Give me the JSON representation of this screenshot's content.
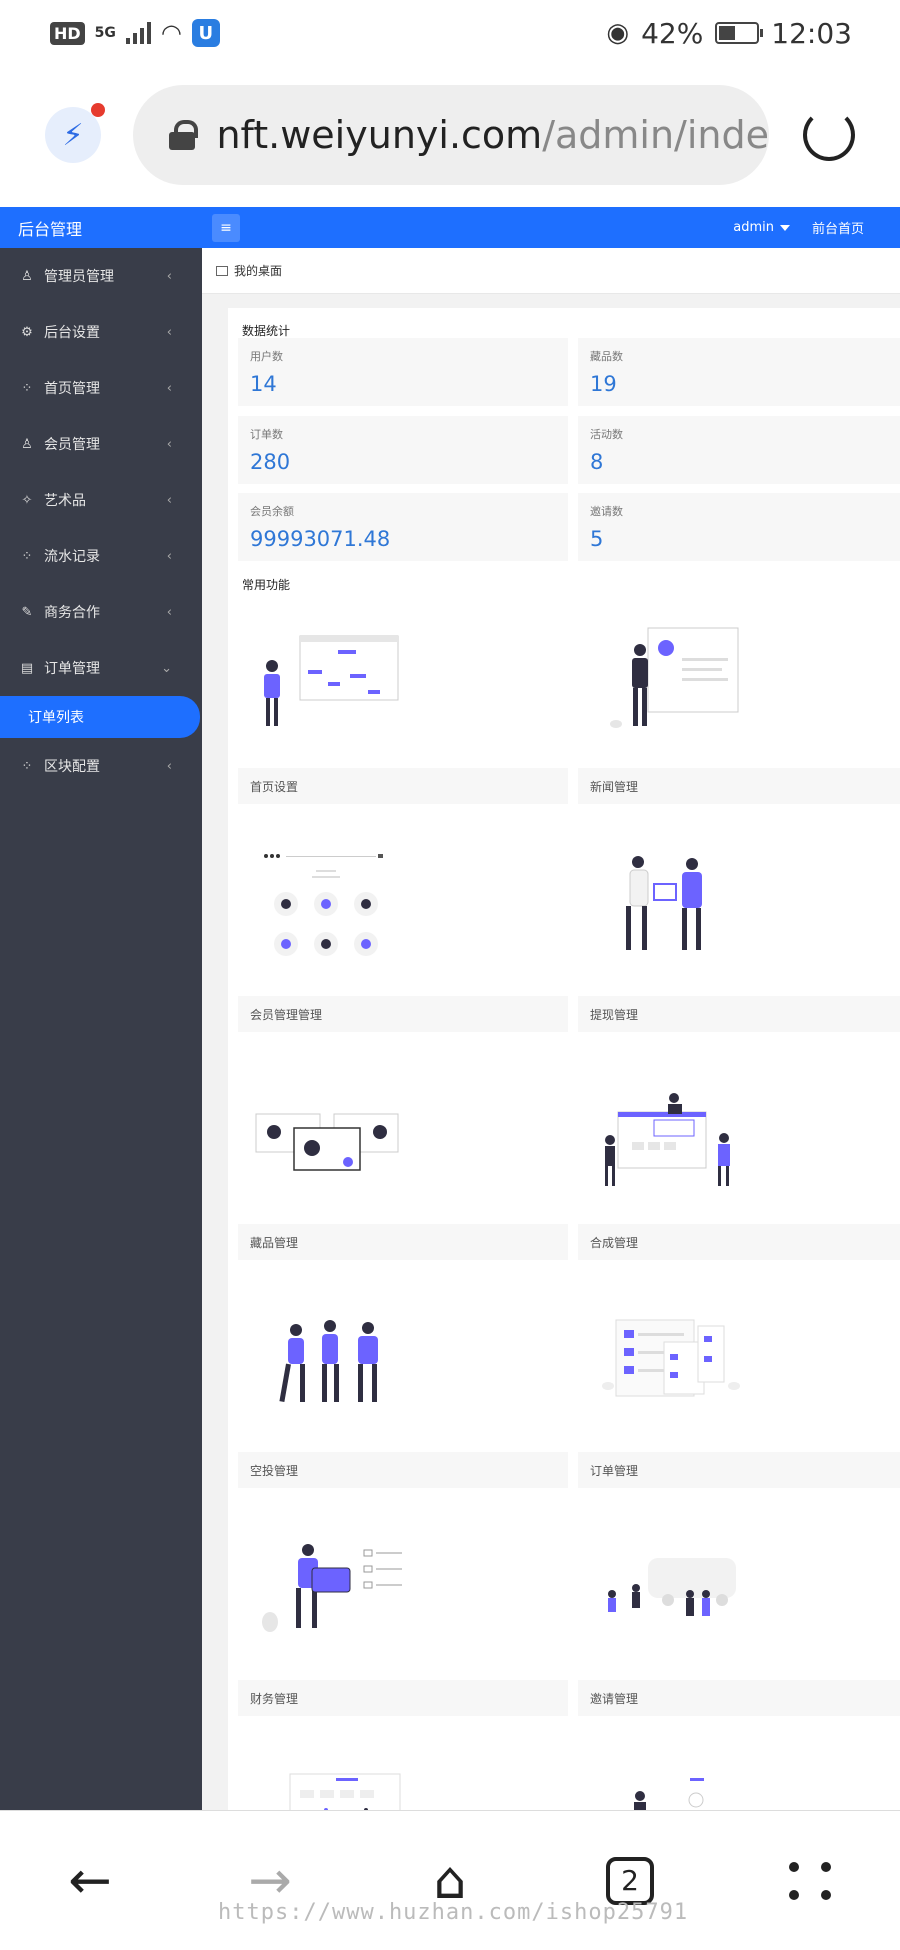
{
  "status_bar": {
    "hd": "HD",
    "network": "5G",
    "battery": "42%",
    "time": "12:03"
  },
  "browser": {
    "url_host": "nft.weiyunyi.com",
    "url_path": "/admin/inde"
  },
  "header": {
    "title": "后台管理",
    "user": "admin",
    "front_link": "前台首页"
  },
  "sidebar": {
    "items": [
      {
        "label": "管理员管理",
        "icon": "user-icon"
      },
      {
        "label": "后台设置",
        "icon": "gear-icon"
      },
      {
        "label": "首页管理",
        "icon": "apps-icon"
      },
      {
        "label": "会员管理",
        "icon": "user-icon"
      },
      {
        "label": "艺术品",
        "icon": "pin-icon"
      },
      {
        "label": "流水记录",
        "icon": "apps-icon"
      },
      {
        "label": "商务合作",
        "icon": "edit-icon"
      },
      {
        "label": "订单管理",
        "icon": "form-icon"
      }
    ],
    "active_sub": "订单列表",
    "last_item": {
      "label": "区块配置",
      "icon": "apps-icon"
    }
  },
  "breadcrumb": "我的桌面",
  "stats": {
    "title": "数据统计",
    "items": [
      {
        "label": "用户数",
        "value": "14"
      },
      {
        "label": "藏品数",
        "value": "19"
      },
      {
        "label": "订单数",
        "value": "280"
      },
      {
        "label": "活动数",
        "value": "8"
      },
      {
        "label": "会员余额",
        "value": "99993071.48"
      },
      {
        "label": "邀请数",
        "value": "5"
      }
    ]
  },
  "functions": {
    "title": "常用功能",
    "items": [
      "首页设置",
      "新闻管理",
      "会员管理管理",
      "提现管理",
      "藏品管理",
      "合成管理",
      "空投管理",
      "订单管理",
      "财务管理",
      "邀请管理"
    ]
  },
  "bottom_nav": {
    "tab_count": "2"
  },
  "watermark": "https://www.huzhan.com/ishop25791",
  "colors": {
    "brand": "#1e6fff",
    "sidebar": "#393d49",
    "stat_value": "#2f77d6",
    "illustration": "#6c63ff"
  }
}
